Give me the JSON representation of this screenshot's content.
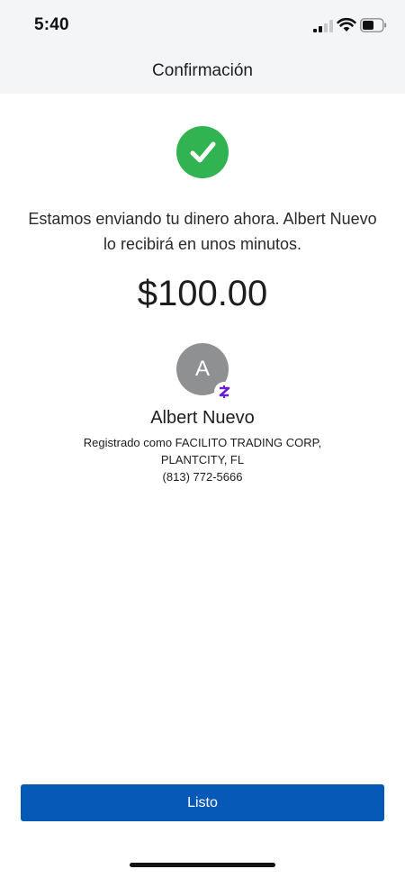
{
  "status_bar": {
    "time": "5:40",
    "signal_icon": "cellular-signal-icon",
    "wifi_icon": "wifi-icon",
    "battery_icon": "battery-icon"
  },
  "header": {
    "title": "Confirmación"
  },
  "confirmation": {
    "success_icon": "checkmark-circle-icon",
    "success_color": "#32b352",
    "message": "Estamos enviando tu dinero ahora. Albert Nuevo lo recibirá en unos minutos.",
    "amount": "$100.00"
  },
  "recipient": {
    "avatar_initial": "A",
    "badge_icon": "zelle-icon",
    "badge_color": "#6d1ed4",
    "name": "Albert Nuevo",
    "registered_line_1": "Registrado como FACILITO TRADING CORP,",
    "registered_line_2": "PLANTCITY, FL",
    "phone": "(813) 772-5666"
  },
  "actions": {
    "done_label": "Listo",
    "button_color": "#0759b8"
  }
}
